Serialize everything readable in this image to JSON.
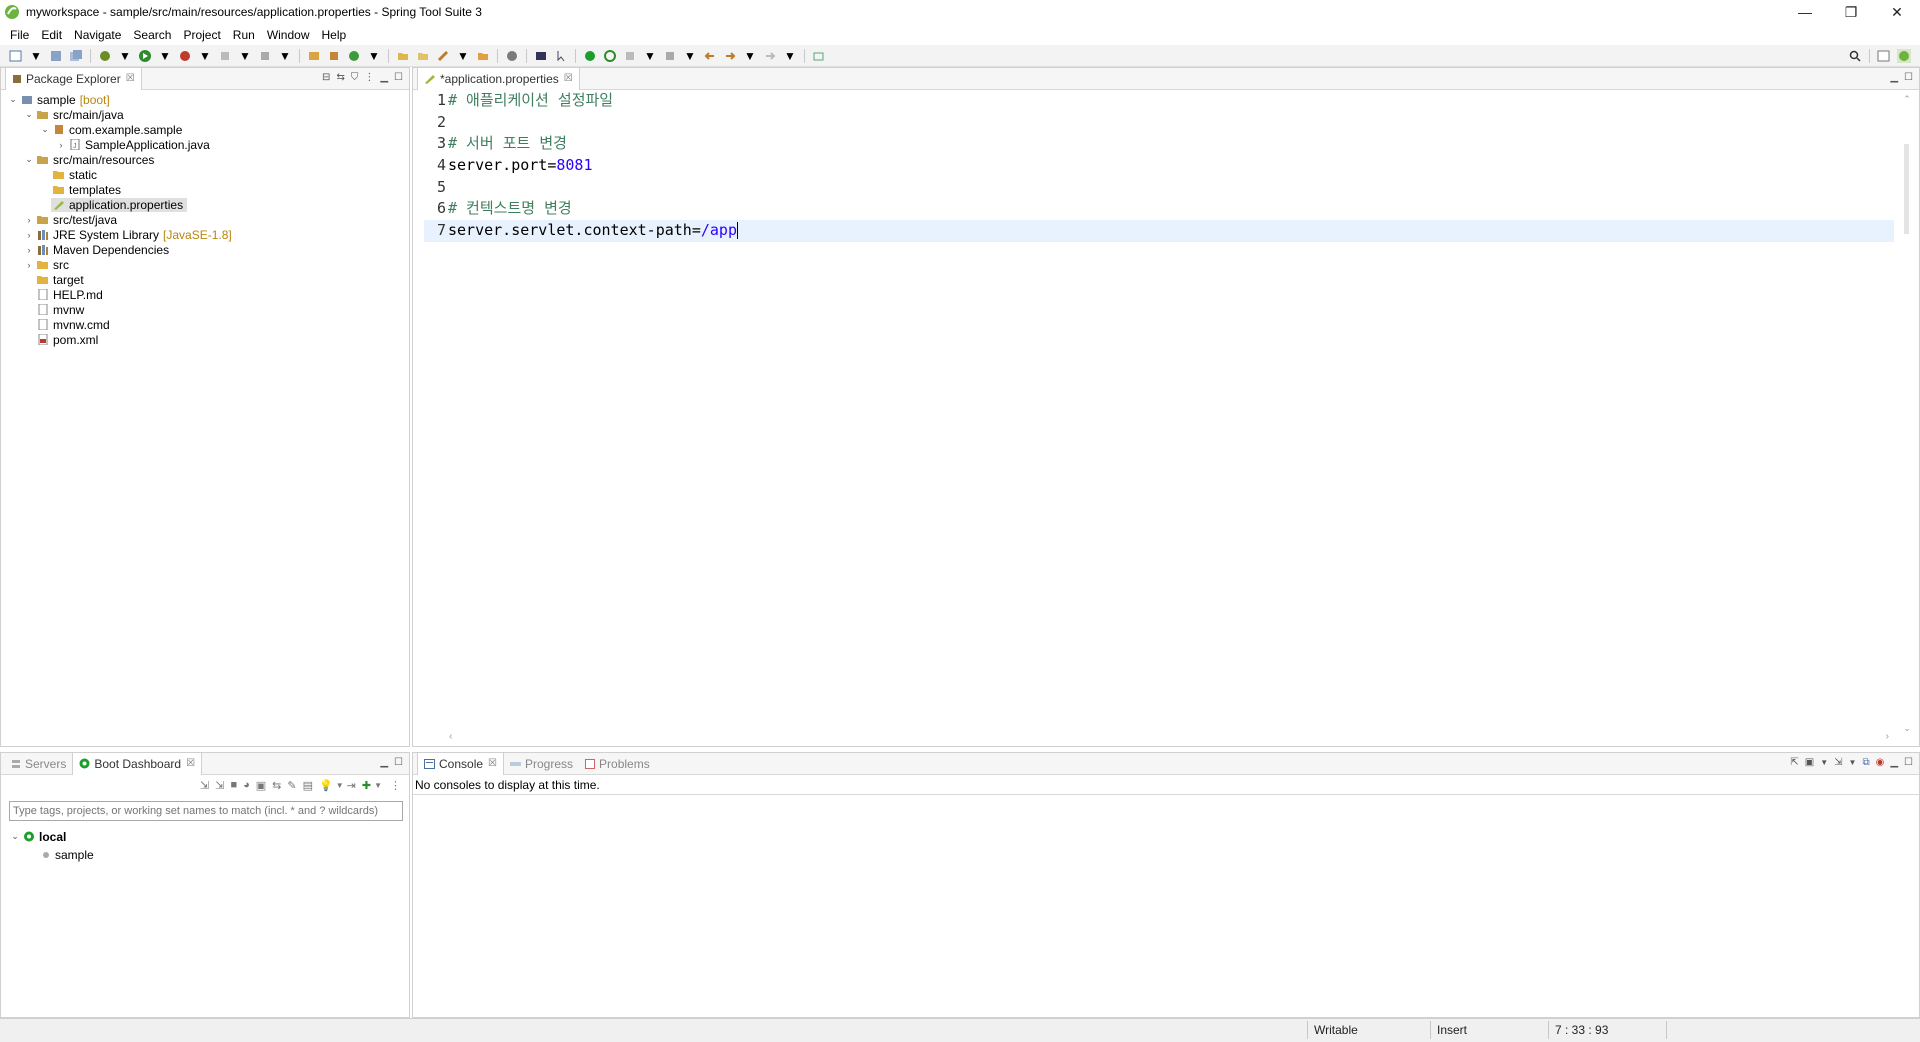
{
  "window": {
    "title": "myworkspace - sample/src/main/resources/application.properties - Spring Tool Suite 3",
    "minimize": "—",
    "restore": "❐",
    "close": "✕"
  },
  "menu": [
    "File",
    "Edit",
    "Navigate",
    "Search",
    "Project",
    "Run",
    "Window",
    "Help"
  ],
  "package_explorer": {
    "tab_label": "Package Explorer",
    "tree": [
      {
        "label": "sample",
        "decor": "[boot]",
        "icon": "project-icon"
      },
      {
        "label": "src/main/java",
        "icon": "source-folder-icon"
      },
      {
        "label": "com.example.sample",
        "icon": "package-icon"
      },
      {
        "label": "SampleApplication.java",
        "icon": "java-file-icon"
      },
      {
        "label": "src/main/resources",
        "icon": "source-folder-icon"
      },
      {
        "label": "static",
        "icon": "folder-icon"
      },
      {
        "label": "templates",
        "icon": "folder-icon"
      },
      {
        "label": "application.properties",
        "icon": "properties-file-icon"
      },
      {
        "label": "src/test/java",
        "icon": "source-folder-icon"
      },
      {
        "label": "JRE System Library",
        "decor": "[JavaSE-1.8]",
        "icon": "library-icon"
      },
      {
        "label": "Maven Dependencies",
        "icon": "library-icon"
      },
      {
        "label": "src",
        "icon": "folder-icon"
      },
      {
        "label": "target",
        "icon": "folder-icon"
      },
      {
        "label": "HELP.md",
        "icon": "file-icon"
      },
      {
        "label": "mvnw",
        "icon": "file-icon"
      },
      {
        "label": "mvnw.cmd",
        "icon": "file-icon"
      },
      {
        "label": "pom.xml",
        "icon": "xml-file-icon"
      }
    ]
  },
  "editor": {
    "tab_label": "*application.properties",
    "lines": [
      {
        "n": "1",
        "comment": "# 애플리케이션 설정파일"
      },
      {
        "n": "2"
      },
      {
        "n": "3",
        "comment": "# 서버 포트 변경"
      },
      {
        "n": "4",
        "key": "server.port=",
        "value": "8081"
      },
      {
        "n": "5"
      },
      {
        "n": "6",
        "comment": "# 컨텍스트명 변경"
      },
      {
        "n": "7",
        "key": "server.servlet.context-path=",
        "value": "/app"
      }
    ]
  },
  "boot_panel": {
    "servers_tab": "Servers",
    "boot_tab": "Boot Dashboard",
    "filter_placeholder": "Type tags, projects, or working set names to match (incl. * and ? wildcards)",
    "local_label": "local",
    "app_label": "sample"
  },
  "console_panel": {
    "console_tab": "Console",
    "progress_tab": "Progress",
    "problems_tab": "Problems",
    "message": "No consoles to display at this time."
  },
  "status": {
    "writable": "Writable",
    "insert": "Insert",
    "position": "7 : 33 : 93"
  },
  "colors": {
    "comment": "#3f7f5f",
    "value": "#2a00ff",
    "current_line": "#e8f2fe",
    "boot_green": "#1b9e2a"
  }
}
